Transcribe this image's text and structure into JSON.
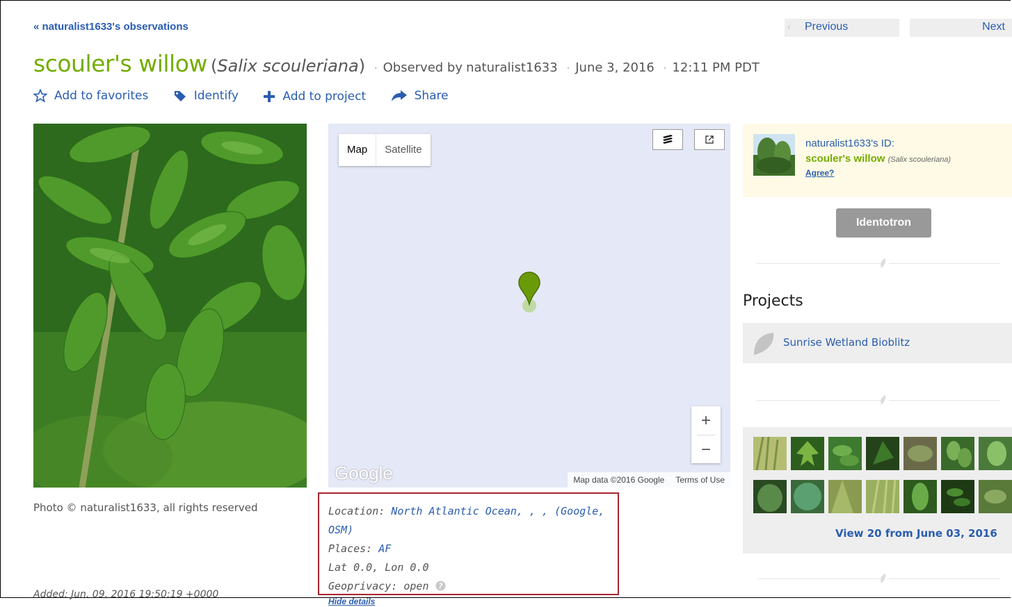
{
  "nav": {
    "back_link": "« naturalist1633's observations",
    "previous": "Previous",
    "next": "Next"
  },
  "observation": {
    "common_name": "scouler's willow",
    "scientific_name": "Salix scouleriana",
    "observed_by_prefix": "Observed by",
    "observer": "naturalist1633",
    "date": "June 3, 2016",
    "time": "12:11 PM PDT"
  },
  "actions": {
    "favorites": "Add to favorites",
    "identify": "Identify",
    "add_to_project": "Add to project",
    "share": "Share"
  },
  "photo": {
    "credit": "Photo © naturalist1633, all rights reserved"
  },
  "added": {
    "label": "Added:",
    "value": "Jun. 09, 2016 19:50:19 +0000"
  },
  "map": {
    "type_map": "Map",
    "type_satellite": "Satellite",
    "zoom_in": "+",
    "zoom_out": "−",
    "logo": "Google",
    "attribution": "Map data ©2016 Google",
    "terms": "Terms of Use"
  },
  "location": {
    "location_label": "Location:",
    "location_value": "North Atlantic Ocean, , , (Google, OSM)",
    "places_label": "Places:",
    "places_value": "AF",
    "latlon": "Lat 0.0, Lon 0.0",
    "geoprivacy_label": "Geoprivacy:",
    "geoprivacy_value": "open",
    "hide_details": "Hide details"
  },
  "identification": {
    "title": "naturalist1633's ID:",
    "common_name": "scouler's willow",
    "scientific_name": "(Salix scouleriana)",
    "agree": "Agree?"
  },
  "identotron": "Identotron",
  "projects": {
    "title": "Projects",
    "items": [
      {
        "name": "Sunrise Wetland Bioblitz"
      }
    ]
  },
  "similar": {
    "view_more": "View 20 from June 03, 2016"
  },
  "colors": {
    "accent_green": "#74ac00",
    "link_blue": "#2a5db0",
    "highlight_border": "#a8262f"
  }
}
